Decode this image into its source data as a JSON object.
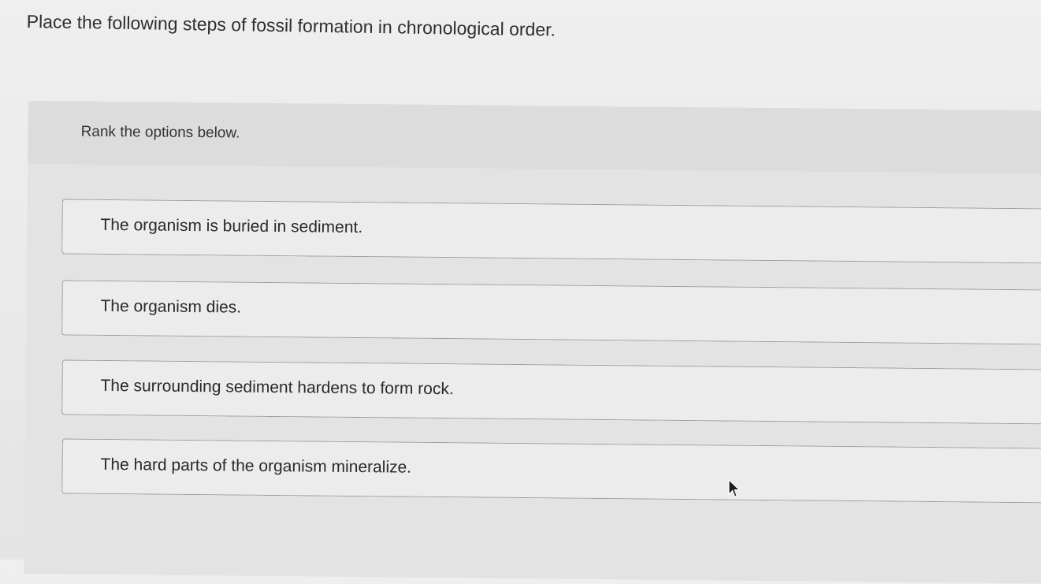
{
  "question": {
    "text": "Place the following steps of fossil formation in chronological order."
  },
  "ranking": {
    "instruction": "Rank the options below.",
    "options": [
      {
        "label": "The organism is buried in sediment."
      },
      {
        "label": "The organism dies."
      },
      {
        "label": "The surrounding sediment hardens to form rock."
      },
      {
        "label": "The hard parts of the organism mineralize."
      }
    ]
  },
  "icons": {
    "cursor": "mouse-pointer-icon"
  },
  "colors": {
    "background": "#ececec",
    "panel": "#e3e3e3",
    "option_border": "#9c9c9c",
    "text": "#2a2a2a"
  }
}
